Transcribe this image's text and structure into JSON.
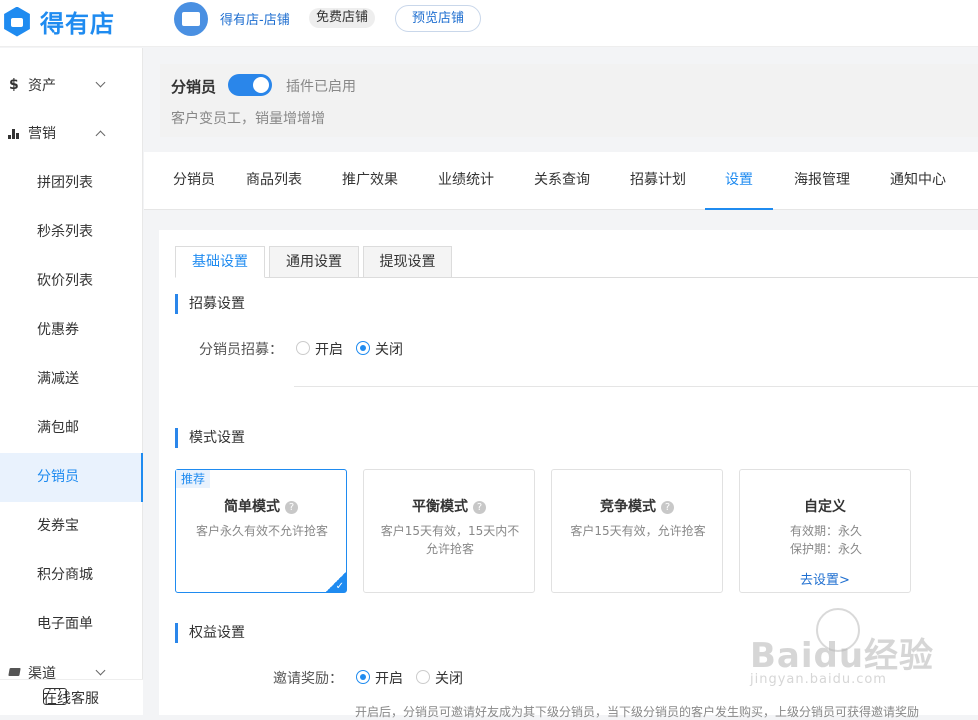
{
  "header": {
    "brand": "得有店",
    "shop_name": "得有店-店铺",
    "shop_badge": "免费店铺",
    "preview_label": "预览店铺"
  },
  "sidebar": {
    "groups": [
      {
        "icon": "$",
        "label": "资产",
        "state": "collapsed"
      },
      {
        "icon": "bar-chart-icon",
        "label": "营销",
        "state": "expanded"
      },
      {
        "icon": "layers-icon",
        "label": "渠道",
        "state": "collapsed"
      }
    ],
    "items": [
      "拼团列表",
      "秒杀列表",
      "砍价列表",
      "优惠券",
      "满减送",
      "满包邮",
      "分销员",
      "发券宝",
      "积分商城",
      "电子面单"
    ],
    "active_item": "分销员",
    "support_label": "在线客服"
  },
  "plugin": {
    "title": "分销员",
    "enabled": true,
    "status": "插件已启用",
    "description": "客户变员工，销量增增增"
  },
  "tabs": [
    "分销员",
    "商品列表",
    "推广效果",
    "业绩统计",
    "关系查询",
    "招募计划",
    "设置",
    "海报管理",
    "通知中心"
  ],
  "active_tab": "设置",
  "subtabs": [
    "基础设置",
    "通用设置",
    "提现设置"
  ],
  "active_subtab": "基础设置",
  "recruit": {
    "section_title": "招募设置",
    "label": "分销员招募：",
    "options": [
      "开启",
      "关闭"
    ],
    "selected": "关闭"
  },
  "mode": {
    "section_title": "模式设置",
    "cards": [
      {
        "tag": "推荐",
        "name": "简单模式",
        "desc": "客户永久有效不允许抢客",
        "selected": true
      },
      {
        "name": "平衡模式",
        "desc": "客户15天有效，15天内不允许抢客"
      },
      {
        "name": "竞争模式",
        "desc": "客户15天有效，允许抢客"
      },
      {
        "name": "自定义",
        "desc_line1": "有效期：永久",
        "desc_line2": "保护期：永久",
        "link": "去设置>"
      }
    ]
  },
  "rights": {
    "section_title": "权益设置",
    "label": "邀请奖励：",
    "options": [
      "开启",
      "关闭"
    ],
    "selected": "开启",
    "note": "开启后，分销员可邀请好友成为其下级分销员，当下级分销员的客户发生购买，上级分销员可获得邀请奖励"
  },
  "watermark": {
    "line1": "Baidu经验",
    "line2": "jingyan.baidu.com"
  },
  "colors": {
    "accent": "#1f8bf0",
    "active_bg": "#e9f2fd"
  }
}
